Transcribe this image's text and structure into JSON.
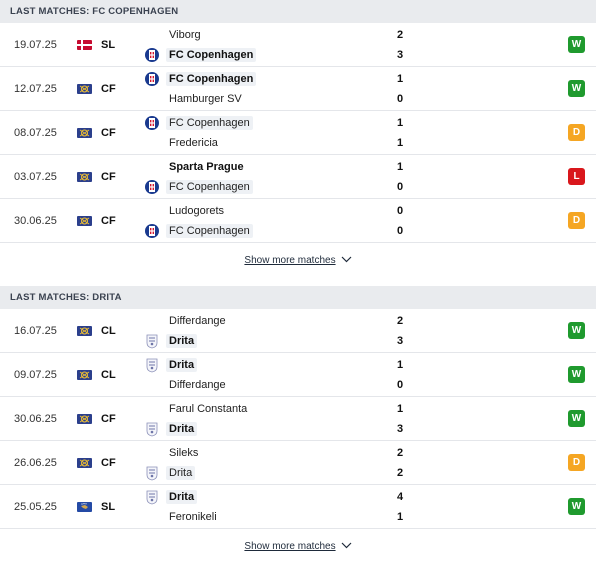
{
  "colors": {
    "win": "#1f9a2e",
    "draw": "#f5a623",
    "loss": "#d9171c"
  },
  "sections": [
    {
      "title": "LAST MATCHES: FC COPENHAGEN",
      "show_more": "Show more matches",
      "matches": [
        {
          "date": "19.07.25",
          "comp": "SL",
          "flag": "dk",
          "home": {
            "name": "Viborg",
            "crest": "none",
            "hl": false,
            "bold": false
          },
          "away": {
            "name": "FC Copenhagen",
            "crest": "fck",
            "hl": true,
            "bold": true
          },
          "score_home": "2",
          "score_away": "3",
          "result": "W"
        },
        {
          "date": "12.07.25",
          "comp": "CF",
          "flag": "int",
          "home": {
            "name": "FC Copenhagen",
            "crest": "fck",
            "hl": true,
            "bold": true
          },
          "away": {
            "name": "Hamburger SV",
            "crest": "none",
            "hl": false,
            "bold": false
          },
          "score_home": "1",
          "score_away": "0",
          "result": "W"
        },
        {
          "date": "08.07.25",
          "comp": "CF",
          "flag": "int",
          "home": {
            "name": "FC Copenhagen",
            "crest": "fck",
            "hl": true,
            "bold": false
          },
          "away": {
            "name": "Fredericia",
            "crest": "none",
            "hl": false,
            "bold": false
          },
          "score_home": "1",
          "score_away": "1",
          "result": "D"
        },
        {
          "date": "03.07.25",
          "comp": "CF",
          "flag": "int",
          "home": {
            "name": "Sparta Prague",
            "crest": "none",
            "hl": false,
            "bold": true
          },
          "away": {
            "name": "FC Copenhagen",
            "crest": "fck",
            "hl": true,
            "bold": false
          },
          "score_home": "1",
          "score_away": "0",
          "result": "L"
        },
        {
          "date": "30.06.25",
          "comp": "CF",
          "flag": "int",
          "home": {
            "name": "Ludogorets",
            "crest": "none",
            "hl": false,
            "bold": false
          },
          "away": {
            "name": "FC Copenhagen",
            "crest": "fck",
            "hl": true,
            "bold": false
          },
          "score_home": "0",
          "score_away": "0",
          "result": "D"
        }
      ]
    },
    {
      "title": "LAST MATCHES: DRITA",
      "show_more": "Show more matches",
      "matches": [
        {
          "date": "16.07.25",
          "comp": "CL",
          "flag": "int",
          "home": {
            "name": "Differdange",
            "crest": "none",
            "hl": false,
            "bold": false
          },
          "away": {
            "name": "Drita",
            "crest": "drita",
            "hl": true,
            "bold": true
          },
          "score_home": "2",
          "score_away": "3",
          "result": "W"
        },
        {
          "date": "09.07.25",
          "comp": "CL",
          "flag": "int",
          "home": {
            "name": "Drita",
            "crest": "drita",
            "hl": true,
            "bold": true
          },
          "away": {
            "name": "Differdange",
            "crest": "none",
            "hl": false,
            "bold": false
          },
          "score_home": "1",
          "score_away": "0",
          "result": "W"
        },
        {
          "date": "30.06.25",
          "comp": "CF",
          "flag": "int",
          "home": {
            "name": "Farul Constanta",
            "crest": "none",
            "hl": false,
            "bold": false
          },
          "away": {
            "name": "Drita",
            "crest": "drita",
            "hl": true,
            "bold": true
          },
          "score_home": "1",
          "score_away": "3",
          "result": "W"
        },
        {
          "date": "26.06.25",
          "comp": "CF",
          "flag": "int",
          "home": {
            "name": "Sileks",
            "crest": "none",
            "hl": false,
            "bold": false
          },
          "away": {
            "name": "Drita",
            "crest": "drita",
            "hl": true,
            "bold": false
          },
          "score_home": "2",
          "score_away": "2",
          "result": "D"
        },
        {
          "date": "25.05.25",
          "comp": "SL",
          "flag": "xk",
          "home": {
            "name": "Drita",
            "crest": "drita",
            "hl": true,
            "bold": true
          },
          "away": {
            "name": "Feronikeli",
            "crest": "none",
            "hl": false,
            "bold": false
          },
          "score_home": "4",
          "score_away": "1",
          "result": "W"
        }
      ]
    }
  ]
}
